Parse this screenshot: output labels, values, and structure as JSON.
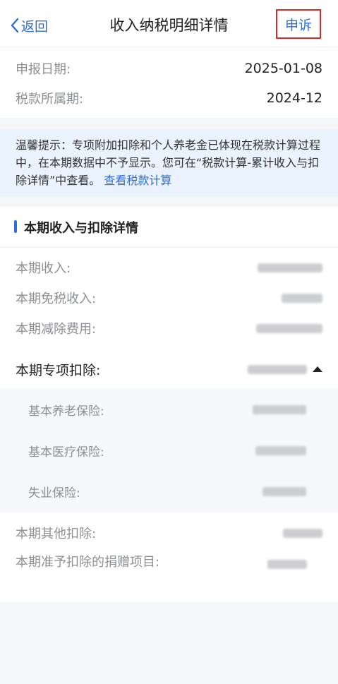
{
  "nav": {
    "back_label": "返回",
    "title": "收入纳税明细详情",
    "appeal_label": "申诉"
  },
  "info": {
    "declare_date_label": "申报日期:",
    "declare_date_value": "2025-01-08",
    "tax_period_label": "税款所属期:",
    "tax_period_value": "2024-12"
  },
  "tip": {
    "text": "温馨提示：专项附加扣除和个人养老金已体现在税款计算过程中，在本期数据中不予显示。您可在“税款计算-累计收入与扣除详情”中查看。",
    "link_label": "查看税款计算"
  },
  "detail": {
    "section_title": "本期收入与扣除详情",
    "income_label": "本期收入:",
    "tax_free_income_label": "本期免税收入:",
    "deduction_fee_label": "本期减除费用:",
    "special_deduction_label": "本期专项扣除:",
    "special_items": [
      {
        "label": "基本养老保险:"
      },
      {
        "label": "基本医疗保险:"
      },
      {
        "label": "失业保险:"
      }
    ],
    "other_deduction_label": "本期其他扣除:",
    "donation_label": "本期准予扣除的捐赠项目:"
  },
  "colors": {
    "accent": "#2d6fd8",
    "highlight_border": "#e2272a",
    "tip_background": "#e9f2fd"
  }
}
